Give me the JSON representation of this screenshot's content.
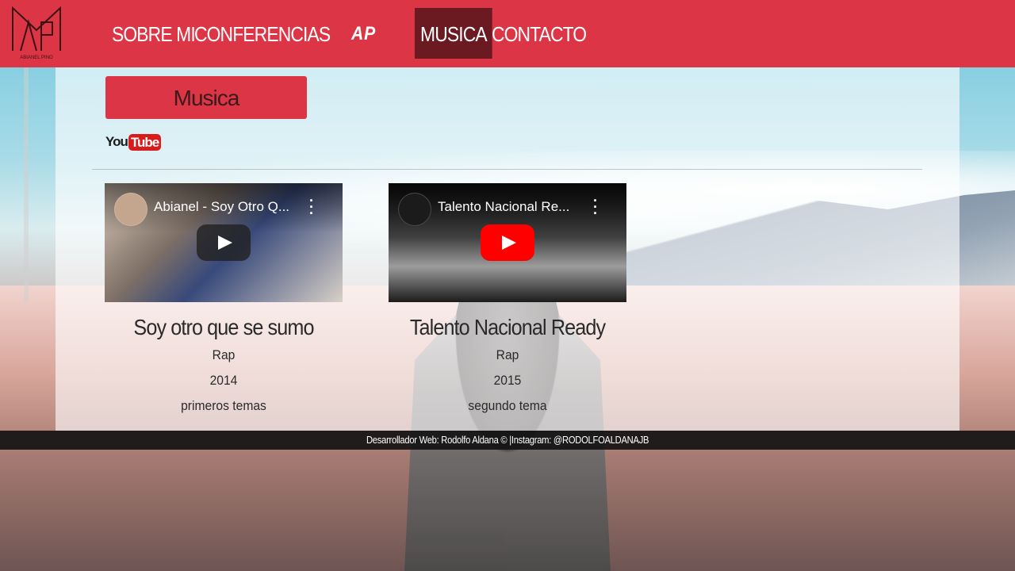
{
  "nav": {
    "brand_name": "ABIANEL PINO",
    "links": [
      "SOBRE MI",
      "CONFERENCIAS",
      "AP",
      "MUSICA",
      "CONTACTO"
    ],
    "active": "MUSICA",
    "color": "#dc3545",
    "active_color": "#6b1a22"
  },
  "section": {
    "title": "Musica",
    "youtube_logo": {
      "you": "You",
      "tube": "Tube"
    }
  },
  "videos": [
    {
      "video_title": "Abianel - Soy Otro Q...",
      "title": "Soy otro que se sumo",
      "genre": "Rap",
      "year": "2014",
      "description": "primeros temas"
    },
    {
      "video_title": "Talento Nacional Re...",
      "title": "Talento Nacional Ready",
      "genre": "Rap",
      "year": "2015",
      "description": "segundo tema"
    }
  ],
  "footer": {
    "text": "Desarrollador Web: Rodolfo Aldana © |Instagram: @RODOLFOALDANAJB"
  },
  "icons": {
    "logo": "ap-monogram-logo",
    "play": "play-icon",
    "menu": "kebab-icon"
  }
}
